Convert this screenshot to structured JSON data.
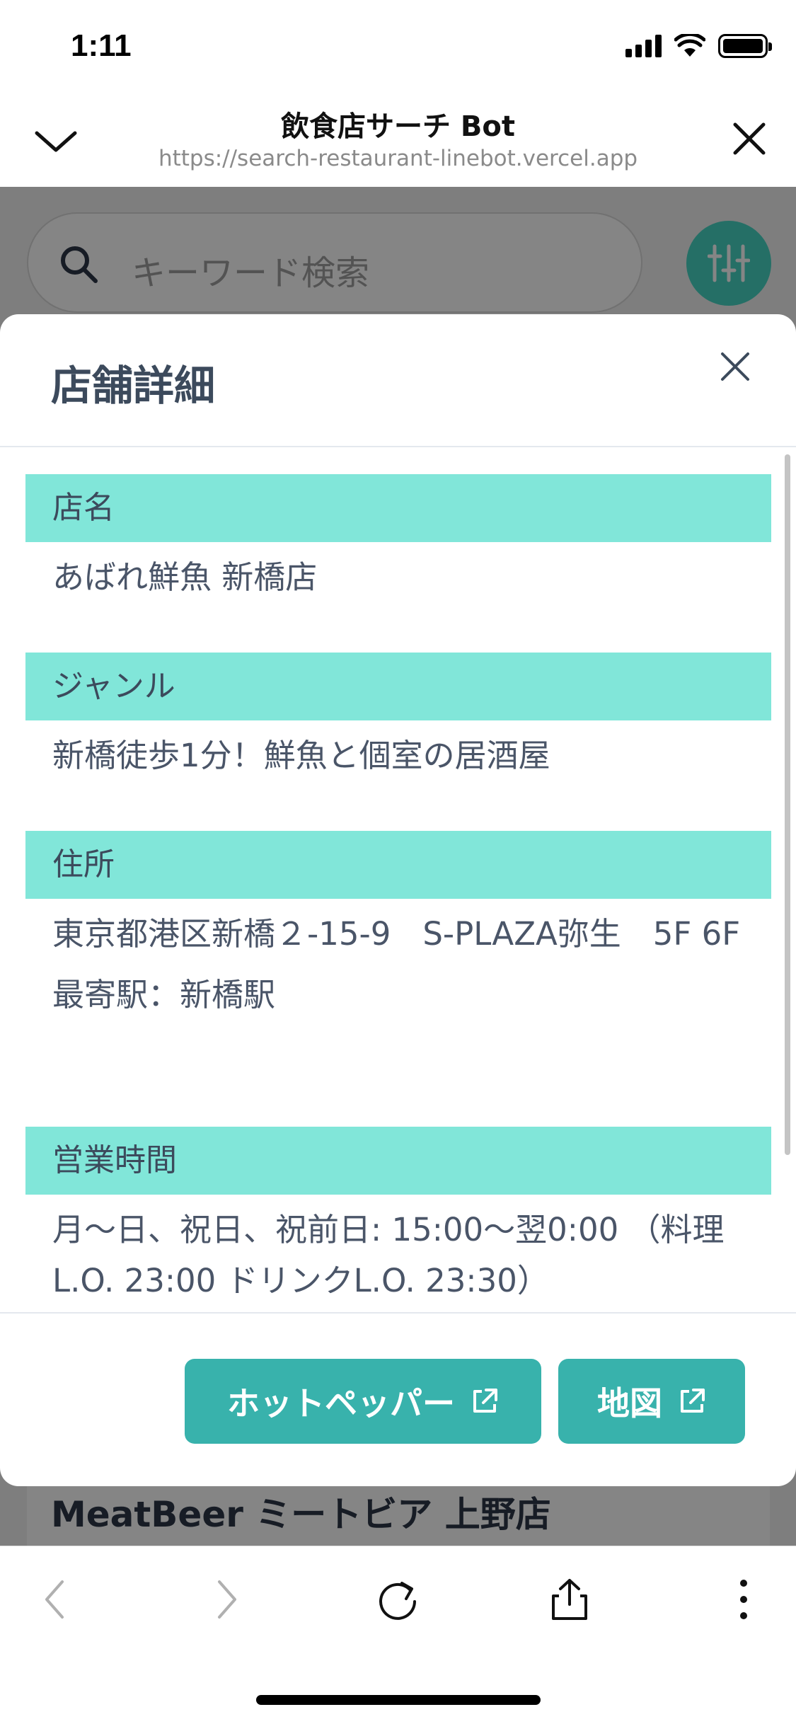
{
  "status_bar": {
    "time": "1:11"
  },
  "browser": {
    "title": "飲食店サーチ Bot",
    "url": "https://search-restaurant-linebot.vercel.app"
  },
  "search": {
    "placeholder": "キーワード検索"
  },
  "background_card": {
    "title": "MeatBeer ミートビア 上野店"
  },
  "modal": {
    "title": "店舗詳細",
    "sections": [
      {
        "label": "店名",
        "lines": [
          "あばれ鮮魚 新橋店"
        ]
      },
      {
        "label": "ジャンル",
        "lines": [
          "新橋徒歩1分！鮮魚と個室の居酒屋"
        ]
      },
      {
        "label": "住所",
        "lines": [
          "東京都港区新橋２-15-9　S-PLAZA弥生　5F 6F",
          "最寄駅：新橋駅"
        ]
      },
      {
        "label": "営業時間",
        "lines": [
          "月～日、祝日、祝前日: 15:00～翌0:00 （料理L.O. 23:00 ドリンクL.O. 23:30）"
        ]
      }
    ],
    "buttons": {
      "hotpepper": "ホットペッパー",
      "map": "地図"
    }
  },
  "colors": {
    "accent": "#38b2ac",
    "section_header": "#81e6d9",
    "filter_button": "#47d5c4"
  }
}
